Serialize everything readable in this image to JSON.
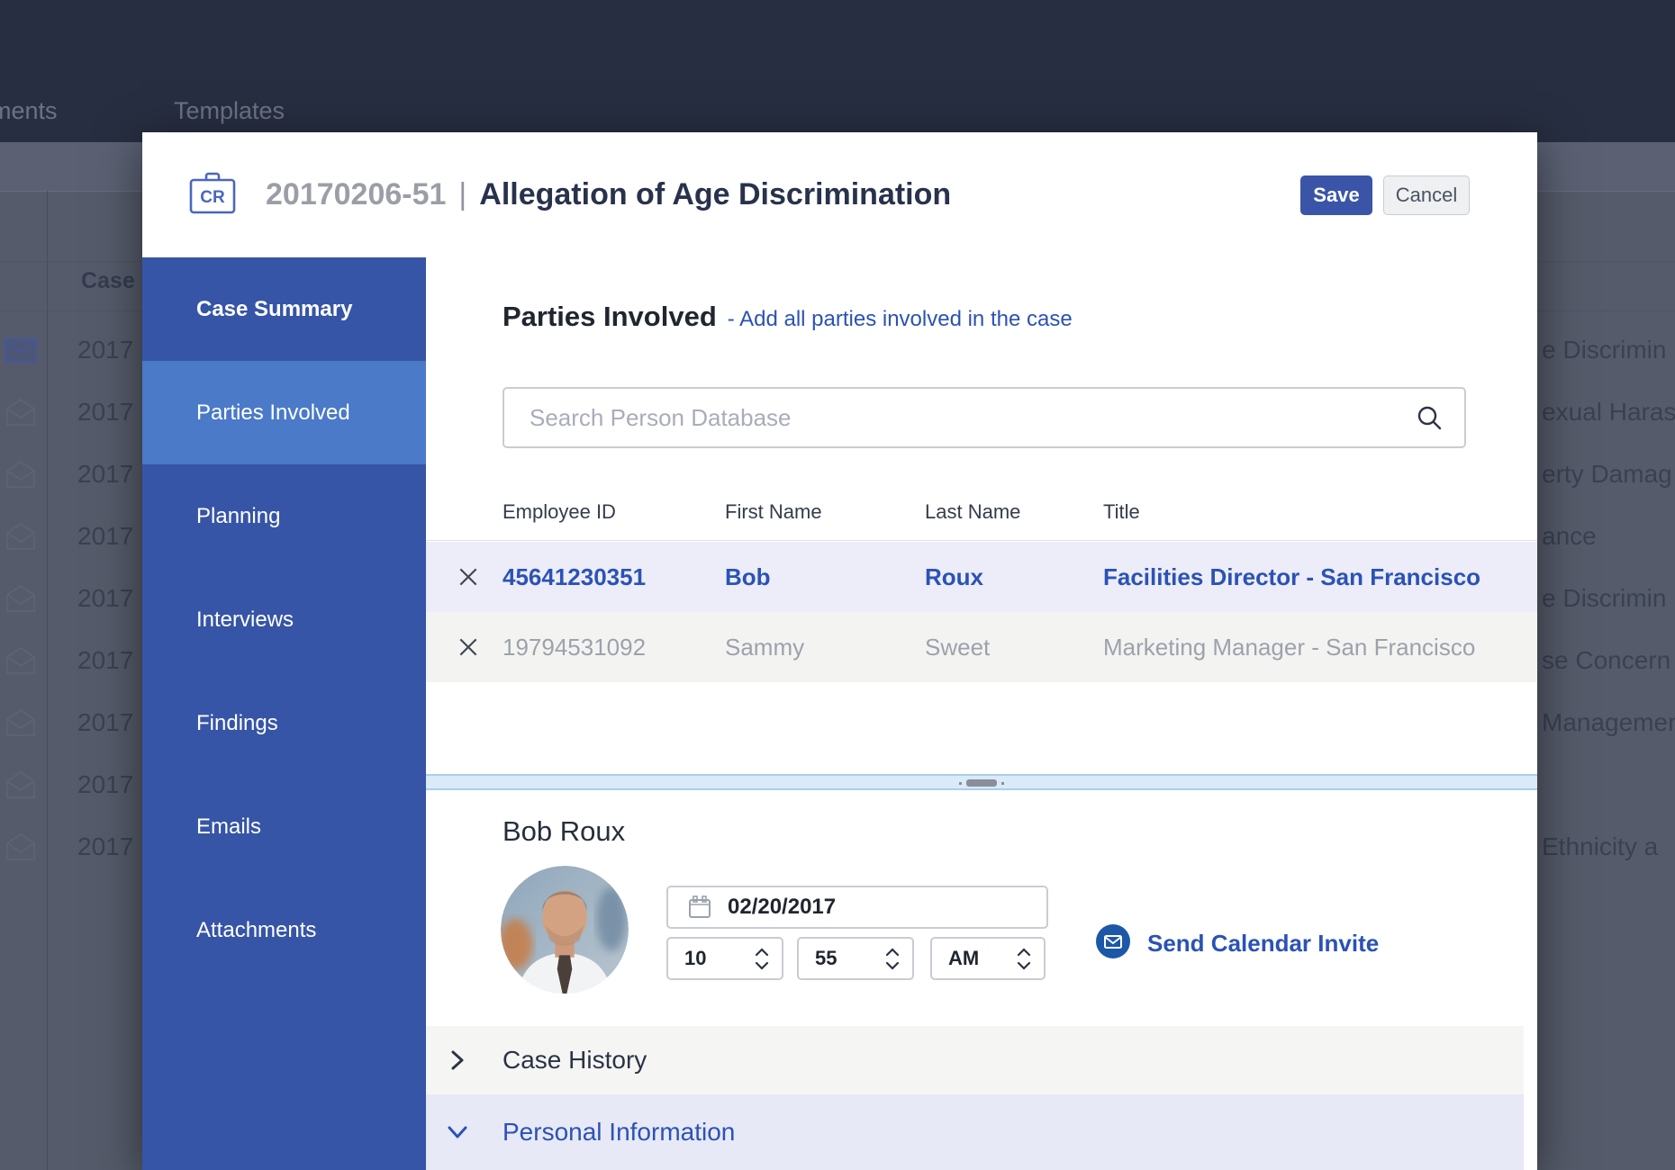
{
  "colors": {
    "accent_blue": "#2b52b5",
    "sidebar_blue": "#3655a6",
    "sidebar_active_blue": "#4a7ac8",
    "save_button_blue": "#3a55a8",
    "invite_icon_blue": "#1c57a8",
    "selected_row_bg": "#ecedf8",
    "topbar_navy": "#272e41",
    "splitter_blue": "#d9eaf8"
  },
  "background": {
    "nav_tabs": [
      {
        "label": "ments"
      },
      {
        "label": "Templates"
      }
    ],
    "table": {
      "case_column_header": "Case",
      "rows": [
        {
          "case_prefix": "2017",
          "right_fragment": "e Discrimin",
          "unread": true
        },
        {
          "case_prefix": "2017",
          "right_fragment": "exual Haras"
        },
        {
          "case_prefix": "2017",
          "right_fragment": "erty Damag"
        },
        {
          "case_prefix": "2017",
          "right_fragment": "ance"
        },
        {
          "case_prefix": "2017",
          "right_fragment": "e Discrimin"
        },
        {
          "case_prefix": "2017",
          "right_fragment": "se Concern"
        },
        {
          "case_prefix": "2017",
          "right_fragment": "Managemen"
        },
        {
          "case_prefix": "2017",
          "right_fragment": ""
        },
        {
          "case_prefix": "2017",
          "right_fragment": "Ethnicity a"
        }
      ]
    }
  },
  "modal": {
    "header": {
      "badge_text": "CR",
      "case_number": "20170206-51",
      "separator": "|",
      "title": "Allegation of Age Discrimination",
      "save_label": "Save",
      "cancel_label": "Cancel"
    },
    "sidebar": {
      "items": [
        {
          "label": "Case Summary",
          "emphasized": true
        },
        {
          "label": "Parties Involved",
          "active": true
        },
        {
          "label": "Planning"
        },
        {
          "label": "Interviews"
        },
        {
          "label": "Findings"
        },
        {
          "label": "Emails"
        },
        {
          "label": "Attachments"
        }
      ]
    },
    "content": {
      "section_title": "Parties Involved",
      "section_subtitle": "- Add all parties involved in the case",
      "search_placeholder": "Search Person Database",
      "table": {
        "columns": [
          "Employee ID",
          "First Name",
          "Last Name",
          "Title"
        ],
        "rows": [
          {
            "employee_id": "45641230351",
            "first_name": "Bob",
            "last_name": "Roux",
            "title": "Facilities Director - San Francisco",
            "selected": true
          },
          {
            "employee_id": "19794531092",
            "first_name": "Sammy",
            "last_name": "Sweet",
            "title": "Marketing Manager - San Francisco",
            "muted": true
          }
        ]
      },
      "detail": {
        "person_name": "Bob Roux",
        "date_value": "02/20/2017",
        "hour_value": "10",
        "minute_value": "55",
        "meridiem_value": "AM",
        "invite_label": "Send Calendar Invite"
      },
      "accordions": [
        {
          "label": "Case History",
          "collapsed": true
        },
        {
          "label": "Personal Information",
          "expanded_blue": true
        }
      ]
    }
  }
}
